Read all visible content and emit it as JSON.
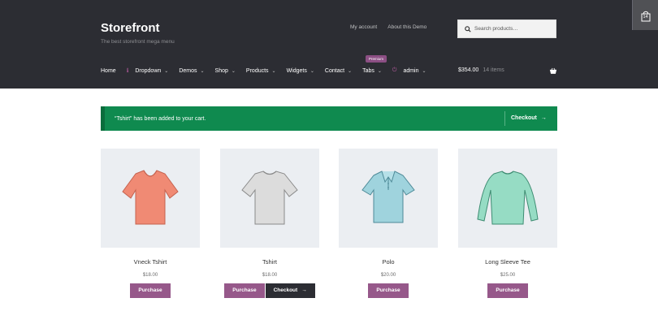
{
  "header": {
    "site_title": "Storefront",
    "site_description": "The best storefront mega menu",
    "secondary_nav": [
      "My account",
      "About this Demo"
    ],
    "search_placeholder": "Search products…"
  },
  "main_nav": [
    {
      "label": "Home",
      "chevron": false,
      "icon": null
    },
    {
      "label": "Dropdown",
      "chevron": true,
      "icon": "info-icon"
    },
    {
      "label": "Demos",
      "chevron": true,
      "icon": null
    },
    {
      "label": "Shop",
      "chevron": true,
      "icon": null
    },
    {
      "label": "Products",
      "chevron": true,
      "icon": null
    },
    {
      "label": "Widgets",
      "chevron": true,
      "icon": null
    },
    {
      "label": "Contact",
      "chevron": true,
      "icon": null
    },
    {
      "label": "Tabs",
      "chevron": true,
      "icon": null
    },
    {
      "label": "admin",
      "chevron": true,
      "icon": "power-icon"
    }
  ],
  "premium_badge": "Premium",
  "cart": {
    "total": "$354.00",
    "items": "14 items",
    "side_count": "14"
  },
  "notice": {
    "message": "“Tshirt” has been added to your cart.",
    "checkout_label": "Checkout"
  },
  "products": [
    {
      "name": "Vneck Tshirt",
      "price": "$18.00",
      "purchase": "Purchase",
      "checkout": null,
      "color": "#f08a74"
    },
    {
      "name": "Tshirt",
      "price": "$18.00",
      "purchase": "Purchase",
      "checkout": "Checkout",
      "color": "#d9d9d9"
    },
    {
      "name": "Polo",
      "price": "$20.00",
      "purchase": "Purchase",
      "checkout": null,
      "color": "#9fd3dd"
    },
    {
      "name": "Long Sleeve Tee",
      "price": "$25.00",
      "purchase": "Purchase",
      "checkout": null,
      "color": "#96dcc4"
    }
  ],
  "colors": {
    "header_bg": "#2c2d33",
    "accent": "#96588a",
    "notice_bg": "#0f8a4f"
  }
}
